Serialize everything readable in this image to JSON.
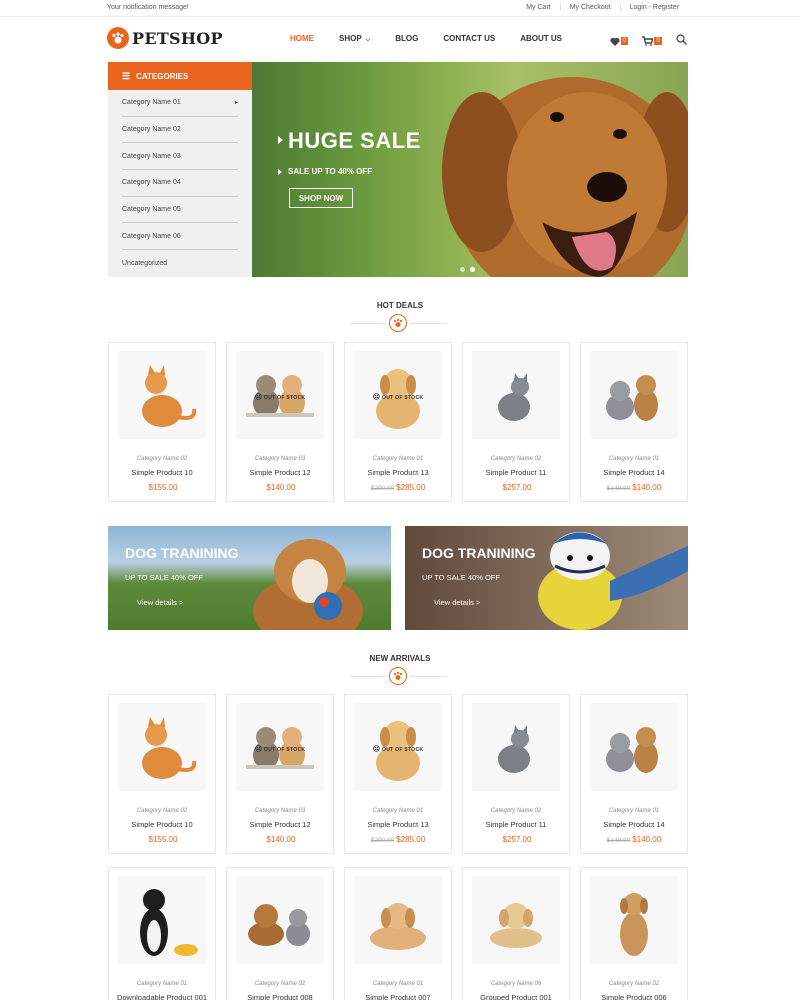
{
  "topbar": {
    "notification": "Your notification message!",
    "links": [
      "My Cart",
      "My Checkout",
      "Login - Register"
    ]
  },
  "header": {
    "logo": "PETSHOP",
    "nav": [
      "HOME",
      "SHOP",
      "BLOG",
      "CONTACT US",
      "ABOUT US"
    ],
    "wishlist_count": "0",
    "cart_count": "0"
  },
  "categories": {
    "title": "CATEGORIES",
    "items": [
      "Category Name 01",
      "Category Name 02",
      "Category Name 03",
      "Category Name 04",
      "Category Name 05",
      "Category Name 06",
      "Uncategorized"
    ]
  },
  "hero": {
    "title": "HUGE SALE",
    "subtitle": "SALE UP TO 40% OFF",
    "button": "SHOP NOW"
  },
  "hot_deals": {
    "title": "HOT DEALS",
    "products": [
      {
        "category": "Category Name 02",
        "name": "Simple Product 10",
        "old_price": "",
        "price": "$155.00",
        "badge": "",
        "icon": "orange-cat-image"
      },
      {
        "category": "Category Name 03",
        "name": "Simple Product 12",
        "old_price": "",
        "price": "$140.00",
        "badge": "OUT OF STOCK",
        "icon": "kittens-image"
      },
      {
        "category": "Category Name 01",
        "name": "Simple Product 13",
        "old_price": "$290.00",
        "price": "$285.00",
        "badge": "OUT OF STOCK",
        "icon": "puppy-image"
      },
      {
        "category": "Category Name 02",
        "name": "Simple Product 11",
        "old_price": "",
        "price": "$257.00",
        "badge": "",
        "icon": "grey-cat-image"
      },
      {
        "category": "Category Name 01",
        "name": "Simple Product 14",
        "old_price": "$149.00",
        "price": "$140.00",
        "badge": "",
        "icon": "cat-and-dog-image"
      }
    ]
  },
  "banners": [
    {
      "title": "DOG TRANINING",
      "subtitle": "UP TO SALE 40% OFF",
      "link": "View details >"
    },
    {
      "title": "DOG TRANINING",
      "subtitle": "UP TO SALE 40% OFF",
      "link": "View details >"
    }
  ],
  "new_arrivals": {
    "title": "NEW ARRIVALS",
    "products": [
      {
        "category": "Category Name 02",
        "name": "Simple Product 10",
        "old_price": "",
        "price": "$155.00",
        "badge": "",
        "icon": "orange-cat-image"
      },
      {
        "category": "Category Name 03",
        "name": "Simple Product 12",
        "old_price": "",
        "price": "$140.00",
        "badge": "OUT OF STOCK",
        "icon": "kittens-image"
      },
      {
        "category": "Category Name 01",
        "name": "Simple Product 13",
        "old_price": "$290.00",
        "price": "$285.00",
        "badge": "OUT OF STOCK",
        "icon": "puppy-image"
      },
      {
        "category": "Category Name 02",
        "name": "Simple Product 11",
        "old_price": "",
        "price": "$257.00",
        "badge": "",
        "icon": "grey-cat-image"
      },
      {
        "category": "Category Name 01",
        "name": "Simple Product 14",
        "old_price": "$149.00",
        "price": "$140.00",
        "badge": "",
        "icon": "cat-and-dog-image"
      },
      {
        "category": "Category Name 01",
        "name": "Downloadable Product 001",
        "old_price": "",
        "price": "",
        "badge": "",
        "icon": "border-collie-image"
      },
      {
        "category": "Category Name 02",
        "name": "Simple Product 008",
        "old_price": "",
        "price": "",
        "badge": "",
        "icon": "dog-and-cat-image"
      },
      {
        "category": "Category Name 01",
        "name": "Simple Product 007",
        "old_price": "",
        "price": "",
        "badge": "",
        "icon": "lying-dog-image"
      },
      {
        "category": "Category Name 06",
        "name": "Grouped Product 001",
        "old_price": "",
        "price": "",
        "badge": "",
        "icon": "retriever-puppy-image"
      },
      {
        "category": "Category Name 02",
        "name": "Simple Product 006",
        "old_price": "",
        "price": "",
        "badge": "",
        "icon": "sitting-dog-image"
      }
    ]
  },
  "colors": {
    "accent": "#e8641f"
  }
}
